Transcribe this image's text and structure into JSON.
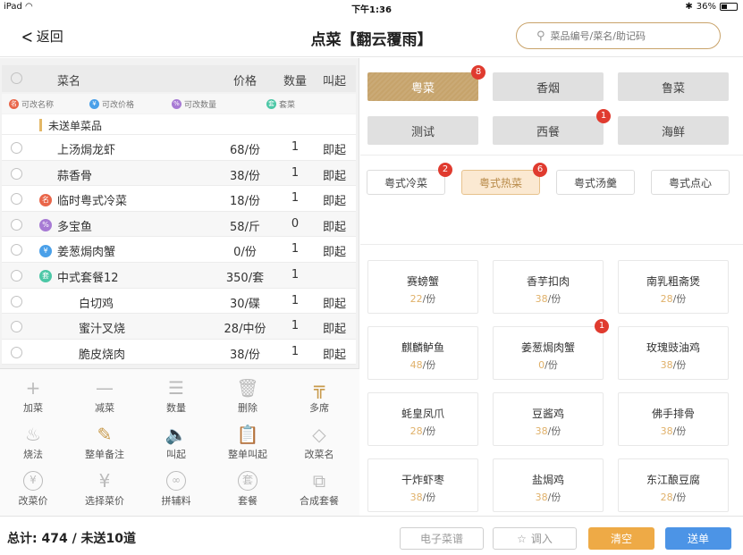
{
  "status_bar": {
    "device": "iPad",
    "wifi_icon": "wifi-icon",
    "time": "下午1:36",
    "bluetooth_icon": "bluetooth-icon",
    "battery": "36%",
    "battery_level": 0.36
  },
  "header": {
    "back_label": "返回",
    "title": "点菜【翻云覆雨】",
    "search_placeholder": "菜品编号/菜名/助记码"
  },
  "order_table": {
    "columns": {
      "name": "菜名",
      "price": "价格",
      "qty": "数量",
      "call": "叫起"
    },
    "legend": [
      {
        "label": "可改名称",
        "color": "#e9664a",
        "glyph": "名"
      },
      {
        "label": "可改价格",
        "color": "#4aa0e9",
        "glyph": "¥"
      },
      {
        "label": "可改数量",
        "color": "#a77ad4",
        "glyph": "%"
      },
      {
        "label": "套菜",
        "color": "#4cc7a6",
        "glyph": "套"
      }
    ],
    "group_label": "未送单菜品",
    "rows": [
      {
        "name": "上汤焗龙虾",
        "price": "68/份",
        "qty": "1",
        "call": "即起",
        "badge": null,
        "indent": 1
      },
      {
        "name": "蒜香骨",
        "price": "38/份",
        "qty": "1",
        "call": "即起",
        "badge": null,
        "indent": 1
      },
      {
        "name": "临时粤式冷菜",
        "price": "18/份",
        "qty": "1",
        "call": "即起",
        "badge": {
          "color": "#e9664a",
          "glyph": "名"
        },
        "indent": 0
      },
      {
        "name": "多宝鱼",
        "price": "58/斤",
        "qty": "0",
        "call": "即起",
        "badge": {
          "color": "#a77ad4",
          "glyph": "%"
        },
        "indent": 0
      },
      {
        "name": "姜葱焗肉蟹",
        "price": "0/份",
        "qty": "1",
        "call": "即起",
        "badge": {
          "color": "#4aa0e9",
          "glyph": "¥"
        },
        "indent": 0
      },
      {
        "name": "中式套餐12",
        "price": "350/套",
        "qty": "1",
        "call": "",
        "badge": {
          "color": "#4cc7a6",
          "glyph": "套"
        },
        "indent": 0
      },
      {
        "name": "白切鸡",
        "price": "30/碟",
        "qty": "1",
        "call": "即起",
        "badge": null,
        "indent": 2
      },
      {
        "name": "蜜汁叉烧",
        "price": "28/中份",
        "qty": "1",
        "call": "即起",
        "badge": null,
        "indent": 2
      },
      {
        "name": "脆皮烧肉",
        "price": "38/份",
        "qty": "1",
        "call": "即起",
        "badge": null,
        "indent": 2
      }
    ]
  },
  "toolbar": [
    {
      "label": "加菜",
      "icon": "plus-icon",
      "glyph": "+",
      "gold": false
    },
    {
      "label": "减菜",
      "icon": "minus-icon",
      "glyph": "—",
      "gold": false
    },
    {
      "label": "数量",
      "icon": "stack-icon",
      "glyph": "☰",
      "gold": false
    },
    {
      "label": "删除",
      "icon": "trash-icon",
      "glyph": "🗑",
      "gold": false
    },
    {
      "label": "多席",
      "icon": "tables-icon",
      "glyph": "╦",
      "gold": true
    },
    {
      "label": "烧法",
      "icon": "cooking-pot-icon",
      "glyph": "♨",
      "gold": false
    },
    {
      "label": "整单备注",
      "icon": "edit-note-icon",
      "glyph": "✎",
      "gold": true
    },
    {
      "label": "叫起",
      "icon": "speaker-icon",
      "glyph": "🔈",
      "gold": false
    },
    {
      "label": "整单叫起",
      "icon": "order-call-icon",
      "glyph": "📋",
      "gold": true
    },
    {
      "label": "改菜名",
      "icon": "tag-icon",
      "glyph": "◇",
      "gold": false
    },
    {
      "label": "改菜价",
      "icon": "yen-circle-icon",
      "glyph": "¥",
      "gold": false
    },
    {
      "label": "选择菜价",
      "icon": "yen-icon",
      "glyph": "¥",
      "gold": false
    },
    {
      "label": "拼辅料",
      "icon": "mix-icon",
      "glyph": "∞",
      "gold": false
    },
    {
      "label": "套餐",
      "icon": "set-meal-icon",
      "glyph": "套",
      "gold": false
    },
    {
      "label": "合成套餐",
      "icon": "combine-icon",
      "glyph": "⧉",
      "gold": false
    }
  ],
  "categories": [
    {
      "label": "粤菜",
      "active": true,
      "badge": "8"
    },
    {
      "label": "香烟",
      "active": false,
      "badge": ""
    },
    {
      "label": "鲁菜",
      "active": false,
      "badge": ""
    },
    {
      "label": "测试",
      "active": false,
      "badge": ""
    },
    {
      "label": "西餐",
      "active": false,
      "badge": "1"
    },
    {
      "label": "海鲜",
      "active": false,
      "badge": ""
    }
  ],
  "subcategories": [
    {
      "label": "粤式冷菜",
      "active": false,
      "badge": "2"
    },
    {
      "label": "粤式热菜",
      "active": true,
      "badge": "6"
    },
    {
      "label": "粤式汤羹",
      "active": false,
      "badge": ""
    },
    {
      "label": "粤式点心",
      "active": false,
      "badge": ""
    }
  ],
  "dishes": [
    {
      "name": "赛螃蟹",
      "price": "22",
      "unit": "/份",
      "badge": ""
    },
    {
      "name": "香芋扣肉",
      "price": "38",
      "unit": "/份",
      "badge": ""
    },
    {
      "name": "南乳粗斋煲",
      "price": "28",
      "unit": "/份",
      "badge": ""
    },
    {
      "name": "麒麟鲈鱼",
      "price": "48",
      "unit": "/份",
      "badge": ""
    },
    {
      "name": "姜葱焗肉蟹",
      "price": "0",
      "unit": "/份",
      "badge": "1"
    },
    {
      "name": "玫瑰豉油鸡",
      "price": "38",
      "unit": "/份",
      "badge": ""
    },
    {
      "name": "蚝皇凤爪",
      "price": "28",
      "unit": "/份",
      "badge": ""
    },
    {
      "name": "豆酱鸡",
      "price": "38",
      "unit": "/份",
      "badge": ""
    },
    {
      "name": "佛手排骨",
      "price": "38",
      "unit": "/份",
      "badge": ""
    },
    {
      "name": "干炸虾枣",
      "price": "38",
      "unit": "/份",
      "badge": ""
    },
    {
      "name": "盐焗鸡",
      "price": "38",
      "unit": "/份",
      "badge": ""
    },
    {
      "name": "东江酿豆腐",
      "price": "28",
      "unit": "/份",
      "badge": ""
    }
  ],
  "footer": {
    "total_label": "总计: 474 / 未送10道",
    "menu_label": "电子菜谱",
    "import_label": "调入",
    "clear_label": "清空",
    "send_label": "送单"
  }
}
